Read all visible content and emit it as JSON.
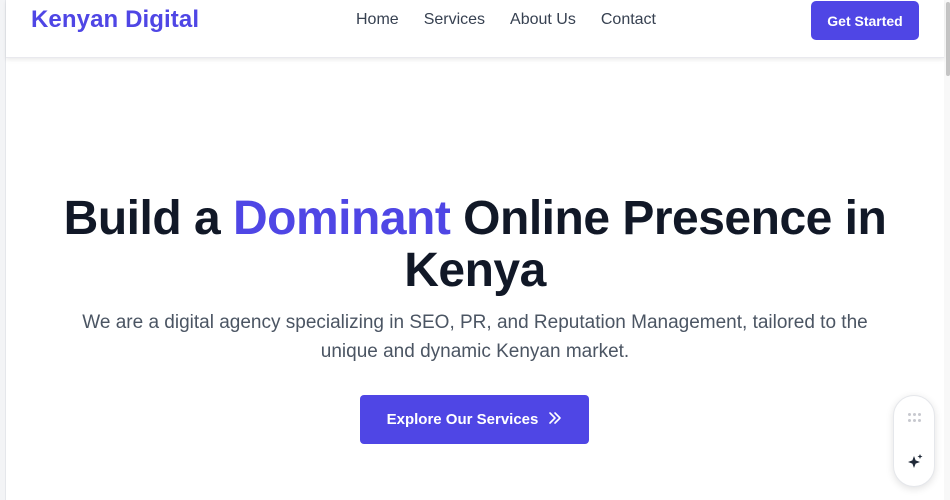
{
  "header": {
    "brand": "Kenyan Digital",
    "nav": [
      "Home",
      "Services",
      "About Us",
      "Contact"
    ],
    "cta_label": "Get Started"
  },
  "hero": {
    "headline_before": "Build a ",
    "headline_accent": "Dominant",
    "headline_after": " Online Presence in Kenya",
    "subheadline": "We are a digital agency specializing in SEO, PR, and Reputation Management, tailored to the unique and dynamic Kenyan market.",
    "button_label": "Explore Our Services",
    "button_icon": "chevrons-right-icon"
  },
  "widget": {
    "icons": [
      "drag-handle-icon",
      "sparkle-icon"
    ]
  },
  "colors": {
    "accent": "#4f46e5",
    "heading": "#111827",
    "body_text": "#4b5563",
    "nav_text": "#374151"
  }
}
